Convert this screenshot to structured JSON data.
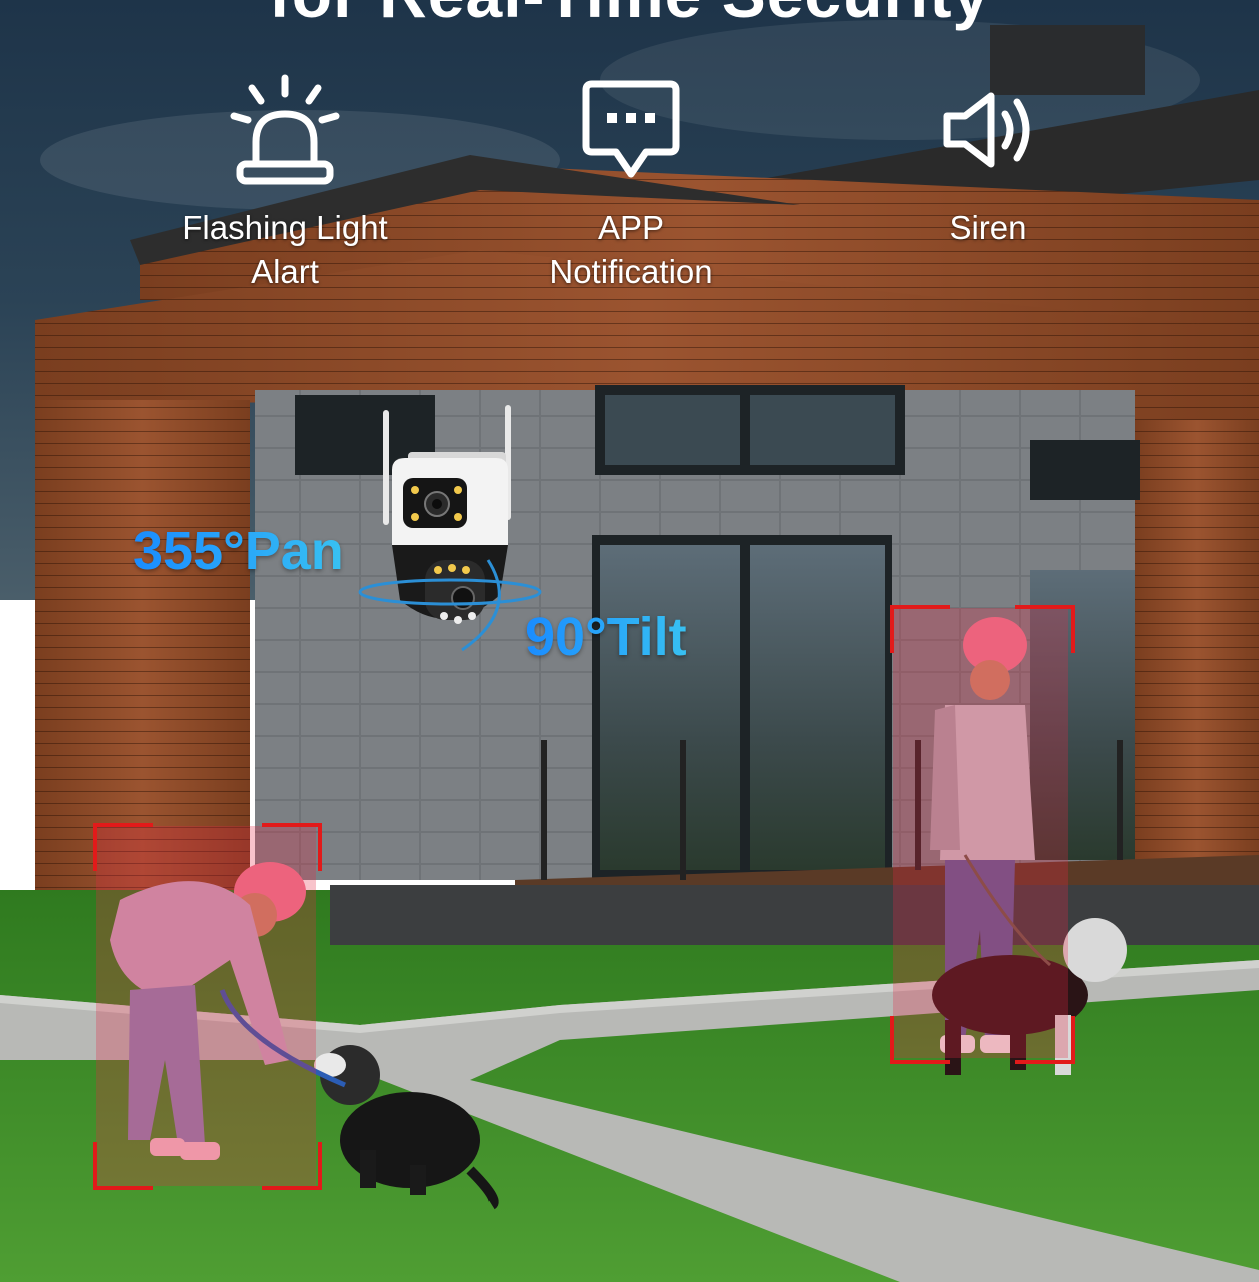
{
  "headline": "for Real-Time Security",
  "features": [
    {
      "icon": "alarm-light-icon",
      "label_line1": "Flashing Light",
      "label_line2": "Alart"
    },
    {
      "icon": "chat-bubble-icon",
      "label_line1": "APP",
      "label_line2": "Notification"
    },
    {
      "icon": "speaker-icon",
      "label_line1": "Siren",
      "label_line2": ""
    }
  ],
  "pan_label": "355°Pan",
  "tilt_label": "90°Tilt",
  "colors": {
    "accent_blue": "#1a8cff",
    "detection_red": "#e21a1a",
    "grass_green": "#3f8f2a",
    "wood_brown": "#8a4a26"
  }
}
